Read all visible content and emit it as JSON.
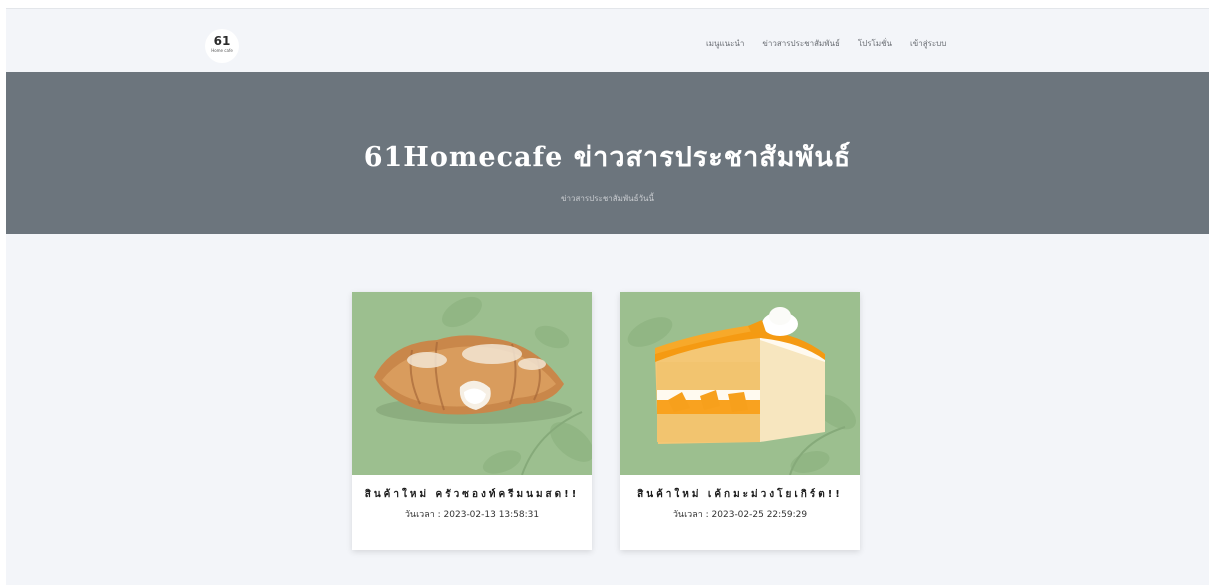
{
  "navbar": {
    "brand_number": "61",
    "brand_subtitle": "Home cafe",
    "links": [
      {
        "label": "เมนูแนะนำ"
      },
      {
        "label": "ข่าวสารประชาสัมพันธ์"
      },
      {
        "label": "โปรโมชั่น"
      },
      {
        "label": "เข้าสู่ระบบ"
      }
    ]
  },
  "hero": {
    "title": "61Homecafe ข่าวสารประชาสัมพันธ์",
    "subtitle": "ข่าวสารประชาสัมพันธ์วันนี้"
  },
  "news": [
    {
      "image": "croissant-cream-image",
      "title": "สินค้าใหม่ ครัวซองท์ครีมนมสด!!",
      "date": "วันเวลา : 2023-02-13 13:58:31"
    },
    {
      "image": "mango-cake-image",
      "title": "สินค้าใหม่ เค้กมะม่วงโยเกิร์ต!!",
      "date": "วันเวลา : 2023-02-25 22:59:29"
    }
  ],
  "colors": {
    "page_background": "#f3f5f9",
    "hero_background": "#6c757d",
    "card_image_background": "#9cbf8f"
  }
}
